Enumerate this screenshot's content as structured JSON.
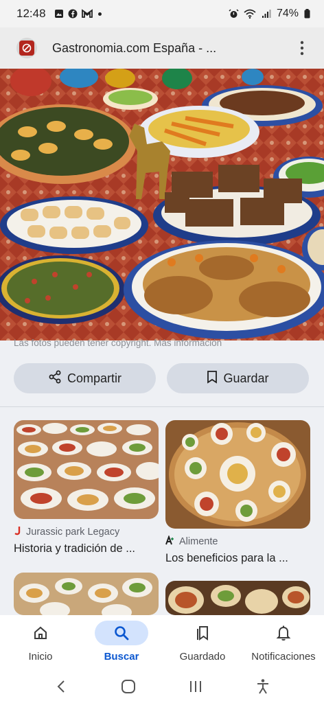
{
  "status_bar": {
    "time": "12:48",
    "battery": "74%",
    "icons": [
      "gallery-icon",
      "facebook-icon",
      "gmail-icon",
      "dot-icon",
      "alarm-icon",
      "wifi-icon",
      "signal-icon",
      "battery-icon"
    ]
  },
  "page_header": {
    "title": "Gastronomia.com España - ...",
    "favicon": "site-favicon",
    "more_icon": "more-vert-icon"
  },
  "hero": {
    "icon": "food-image"
  },
  "notice": {
    "text": "Las fotos pueden tener copyright. Más información"
  },
  "actions": {
    "share_label": "Compartir",
    "save_label": "Guardar"
  },
  "related": [
    {
      "source": "Jurassic park Legacy",
      "title": "Historia y tradición de ..."
    },
    {
      "source": "Alimente",
      "title": "Los beneficios para la ..."
    }
  ],
  "bottom_nav": {
    "items": [
      {
        "label": "Inicio",
        "icon": "home-icon"
      },
      {
        "label": "Buscar",
        "icon": "search-icon"
      },
      {
        "label": "Guardado",
        "icon": "saved-icon"
      },
      {
        "label": "Notificaciones",
        "icon": "bell-icon"
      }
    ],
    "active": "Buscar"
  },
  "colors": {
    "accent": "#0b57d0",
    "active_pill": "#d3e3fd",
    "button_bg": "#d6dbe4",
    "favicon_red": "#b3261e"
  }
}
